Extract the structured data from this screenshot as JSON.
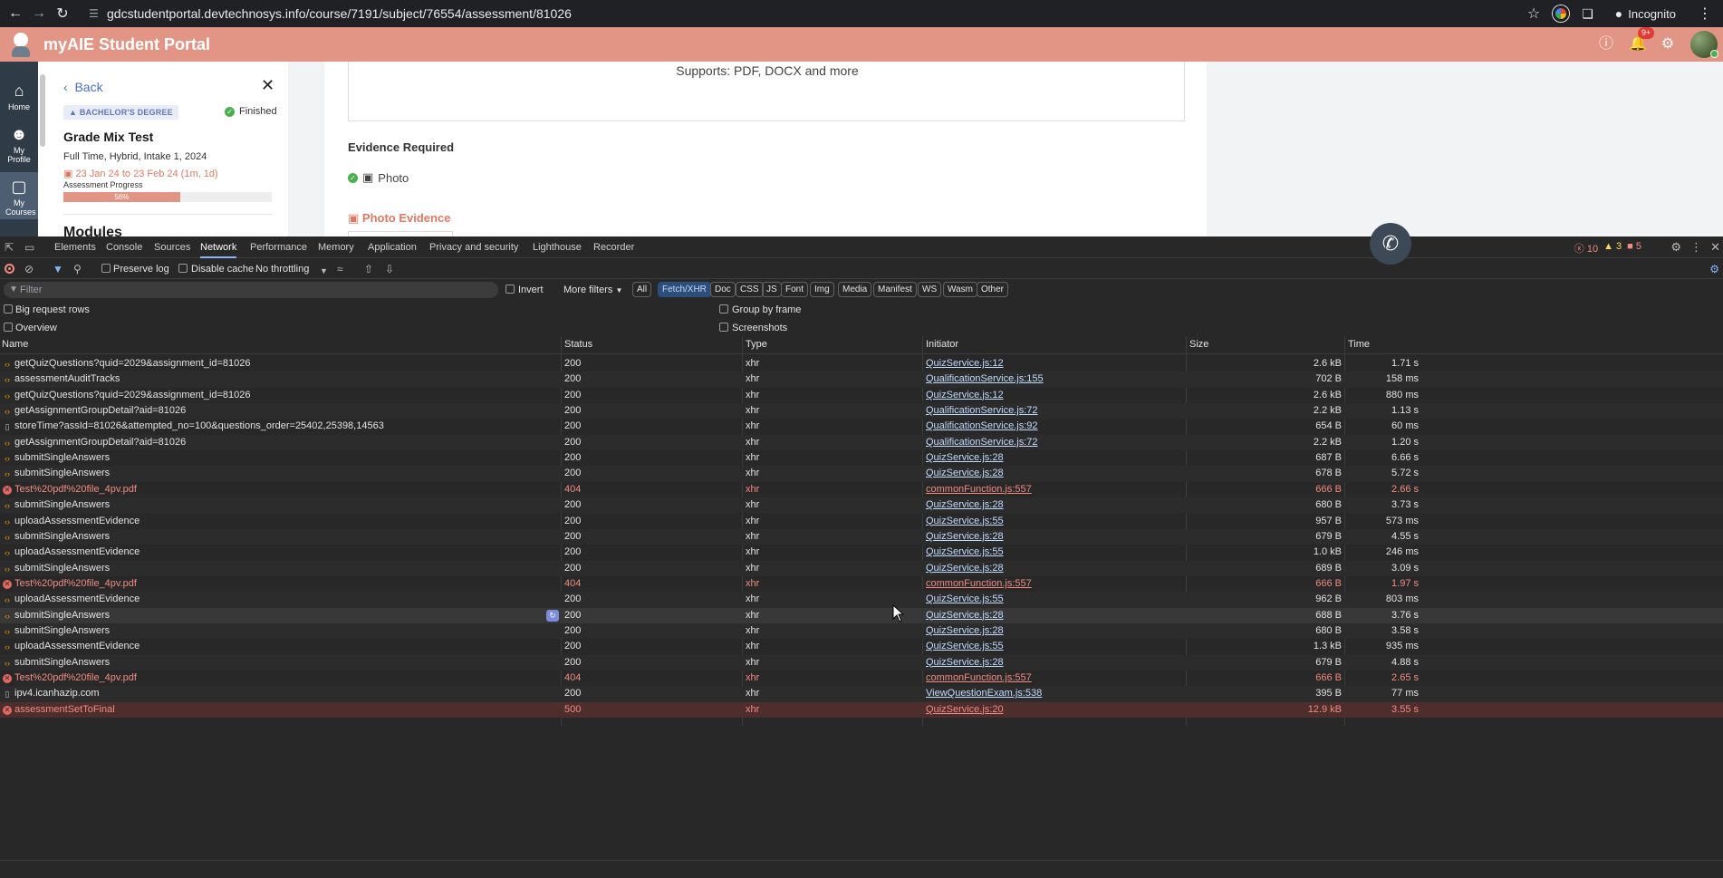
{
  "browser": {
    "url": "gdcstudentportal.devtechnosys.info/course/7191/subject/76554/assessment/81026",
    "profile_label": "Incognito"
  },
  "app": {
    "title": "myAIE Student Portal",
    "notification_count": "9+",
    "header_color": "#e29585"
  },
  "rail": {
    "items": [
      {
        "label": "Home",
        "icon": "home-icon"
      },
      {
        "label": "My Profile",
        "icon": "user-icon"
      },
      {
        "label": "My Courses",
        "icon": "laptop-icon"
      }
    ]
  },
  "side": {
    "back_label": "Back",
    "degree_badge": "BACHELOR'S DEGREE",
    "status": "Finished",
    "group_name": "Grade Mix Test",
    "mode": "Full Time, Hybrid, Intake 1, 2024",
    "dates": "23 Jan 24 to 23 Feb 24 (1m, 1d)",
    "progress_label": "Assessment Progress",
    "progress_text": "56%",
    "progress_value": 0.56,
    "modules_heading": "Modules"
  },
  "main": {
    "supports": "Supports: PDF, DOCX and more",
    "evidence_required": "Evidence Required",
    "evidence_item": "Photo",
    "photo_evidence": "Photo Evidence"
  },
  "devtools": {
    "tabs": [
      "Elements",
      "Console",
      "Sources",
      "Network",
      "Performance",
      "Memory",
      "Application",
      "Privacy and security",
      "Lighthouse",
      "Recorder"
    ],
    "active_tab": "Network",
    "errors": "10",
    "warnings": "3",
    "issues": "5",
    "toolbar": {
      "preserve_log": "Preserve log",
      "disable_cache": "Disable cache",
      "throttling": "No throttling"
    },
    "filter": {
      "placeholder": "Filter",
      "invert": "Invert",
      "more_filters": "More filters",
      "chips": [
        "All",
        "Fetch/XHR",
        "Doc",
        "CSS",
        "JS",
        "Font",
        "Img",
        "Media",
        "Manifest",
        "WS",
        "Wasm",
        "Other"
      ],
      "selected_chip": "Fetch/XHR"
    },
    "options": {
      "big_request_rows": "Big request rows",
      "overview": "Overview",
      "group_by_frame": "Group by frame",
      "screenshots": "Screenshots"
    },
    "columns": [
      "Name",
      "Status",
      "Type",
      "Initiator",
      "Size",
      "Time"
    ],
    "requests": [
      {
        "name": "getQuizQuestions?quid=2029&assignment_id=81026",
        "status": "200",
        "type": "xhr",
        "initiator": "QuizService.js:12",
        "size": "2.6 kB",
        "time": "1.71 s",
        "kind": "xhr"
      },
      {
        "name": "assessmentAuditTracks",
        "status": "200",
        "type": "xhr",
        "initiator": "QualificationService.js:155",
        "size": "702 B",
        "time": "158 ms",
        "kind": "xhr"
      },
      {
        "name": "getQuizQuestions?quid=2029&assignment_id=81026",
        "status": "200",
        "type": "xhr",
        "initiator": "QuizService.js:12",
        "size": "2.6 kB",
        "time": "880 ms",
        "kind": "xhr"
      },
      {
        "name": "getAssignmentGroupDetail?aid=81026",
        "status": "200",
        "type": "xhr",
        "initiator": "QualificationService.js:72",
        "size": "2.2 kB",
        "time": "1.13 s",
        "kind": "xhr"
      },
      {
        "name": "storeTime?assId=81026&attempted_no=100&questions_order=25402,25398,14563",
        "status": "200",
        "type": "xhr",
        "initiator": "QualificationService.js:92",
        "size": "654 B",
        "time": "60 ms",
        "kind": "doc"
      },
      {
        "name": "getAssignmentGroupDetail?aid=81026",
        "status": "200",
        "type": "xhr",
        "initiator": "QualificationService.js:72",
        "size": "2.2 kB",
        "time": "1.20 s",
        "kind": "xhr"
      },
      {
        "name": "submitSingleAnswers",
        "status": "200",
        "type": "xhr",
        "initiator": "QuizService.js:28",
        "size": "687 B",
        "time": "6.66 s",
        "kind": "xhr"
      },
      {
        "name": "submitSingleAnswers",
        "status": "200",
        "type": "xhr",
        "initiator": "QuizService.js:28",
        "size": "678 B",
        "time": "5.72 s",
        "kind": "xhr"
      },
      {
        "name": "Test%20pdf%20file_4pv.pdf",
        "status": "404",
        "type": "xhr",
        "initiator": "commonFunction.js:557",
        "size": "666 B",
        "time": "2.66 s",
        "kind": "err"
      },
      {
        "name": "submitSingleAnswers",
        "status": "200",
        "type": "xhr",
        "initiator": "QuizService.js:28",
        "size": "680 B",
        "time": "3.73 s",
        "kind": "xhr"
      },
      {
        "name": "uploadAssessmentEvidence",
        "status": "200",
        "type": "xhr",
        "initiator": "QuizService.js:55",
        "size": "957 B",
        "time": "573 ms",
        "kind": "xhr"
      },
      {
        "name": "submitSingleAnswers",
        "status": "200",
        "type": "xhr",
        "initiator": "QuizService.js:28",
        "size": "679 B",
        "time": "4.55 s",
        "kind": "xhr"
      },
      {
        "name": "uploadAssessmentEvidence",
        "status": "200",
        "type": "xhr",
        "initiator": "QuizService.js:55",
        "size": "1.0 kB",
        "time": "246 ms",
        "kind": "xhr"
      },
      {
        "name": "submitSingleAnswers",
        "status": "200",
        "type": "xhr",
        "initiator": "QuizService.js:28",
        "size": "689 B",
        "time": "3.09 s",
        "kind": "xhr"
      },
      {
        "name": "Test%20pdf%20file_4pv.pdf",
        "status": "404",
        "type": "xhr",
        "initiator": "commonFunction.js:557",
        "size": "666 B",
        "time": "1.97 s",
        "kind": "err"
      },
      {
        "name": "uploadAssessmentEvidence",
        "status": "200",
        "type": "xhr",
        "initiator": "QuizService.js:55",
        "size": "962 B",
        "time": "803 ms",
        "kind": "xhr"
      },
      {
        "name": "submitSingleAnswers",
        "status": "200",
        "type": "xhr",
        "initiator": "QuizService.js:28",
        "size": "688 B",
        "time": "3.76 s",
        "kind": "xhr"
      },
      {
        "name": "submitSingleAnswers",
        "status": "200",
        "type": "xhr",
        "initiator": "QuizService.js:28",
        "size": "680 B",
        "time": "3.58 s",
        "kind": "xhr"
      },
      {
        "name": "uploadAssessmentEvidence",
        "status": "200",
        "type": "xhr",
        "initiator": "QuizService.js:55",
        "size": "1.3 kB",
        "time": "935 ms",
        "kind": "xhr"
      },
      {
        "name": "submitSingleAnswers",
        "status": "200",
        "type": "xhr",
        "initiator": "QuizService.js:28",
        "size": "679 B",
        "time": "4.88 s",
        "kind": "xhr"
      },
      {
        "name": "Test%20pdf%20file_4pv.pdf",
        "status": "404",
        "type": "xhr",
        "initiator": "commonFunction.js:557",
        "size": "666 B",
        "time": "2.65 s",
        "kind": "err"
      },
      {
        "name": "ipv4.icanhazip.com",
        "status": "200",
        "type": "xhr",
        "initiator": "ViewQuestionExam.js:538",
        "size": "395 B",
        "time": "77 ms",
        "kind": "doc"
      },
      {
        "name": "assessmentSetToFinal",
        "status": "500",
        "type": "xhr",
        "initiator": "QuizService.js:20",
        "size": "12.9 kB",
        "time": "3.55 s",
        "kind": "err"
      }
    ]
  }
}
